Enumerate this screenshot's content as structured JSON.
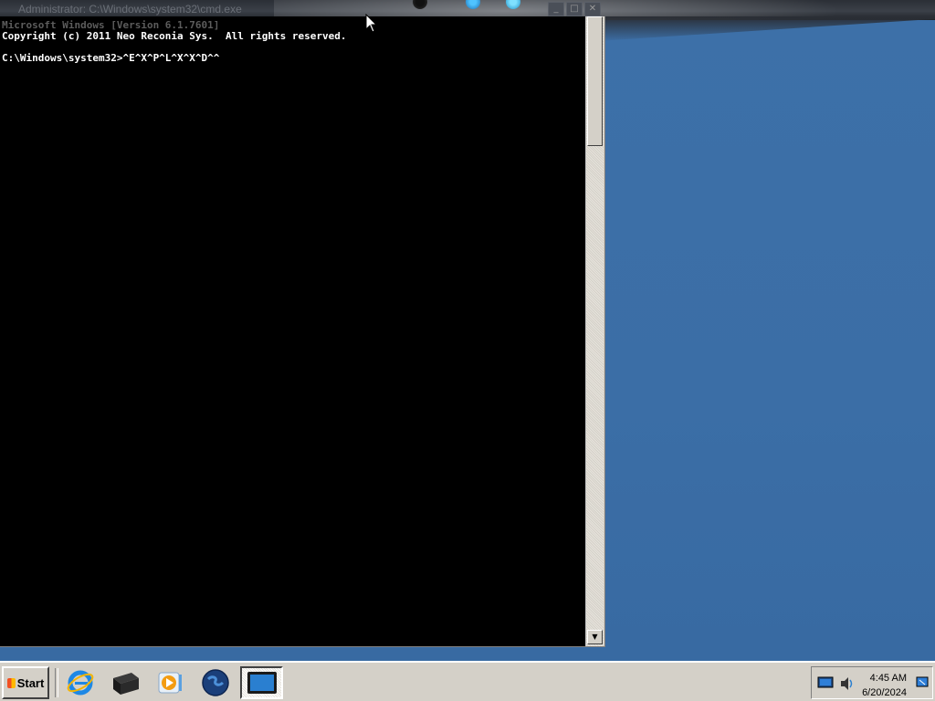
{
  "window": {
    "title": "Administrator: C:\\Windows\\system32\\cmd.exe",
    "controls": [
      "minimize",
      "maximize",
      "close"
    ]
  },
  "console": {
    "lines": [
      {
        "text": "Microsoft Windows [Version 6.1.7601]",
        "faded": true
      },
      {
        "text": "Copyright (c) 2011 Neo Reconia Sys.  All rights reserved.",
        "faded": false
      },
      {
        "text": "",
        "faded": false
      },
      {
        "text": "C:\\Windows\\system32>^E^X^P^L^X^X^D^^",
        "faded": false
      }
    ]
  },
  "taskbar": {
    "start_label": "Start",
    "pinned": [
      {
        "name": "internet-explorer-icon"
      },
      {
        "name": "server-manager-icon"
      },
      {
        "name": "media-player-icon"
      },
      {
        "name": "network-globe-icon"
      },
      {
        "name": "command-prompt-icon",
        "active": true
      }
    ],
    "tray": {
      "time": "4:45 AM",
      "date": "6/20/2024",
      "icons": [
        "network-icon",
        "volume-icon",
        "notification-icon"
      ]
    }
  },
  "colors": {
    "desktop": "#3b6ea6",
    "console_bg": "#000000",
    "console_fg": "#ffffff",
    "taskbar": "#d4d0c8"
  }
}
